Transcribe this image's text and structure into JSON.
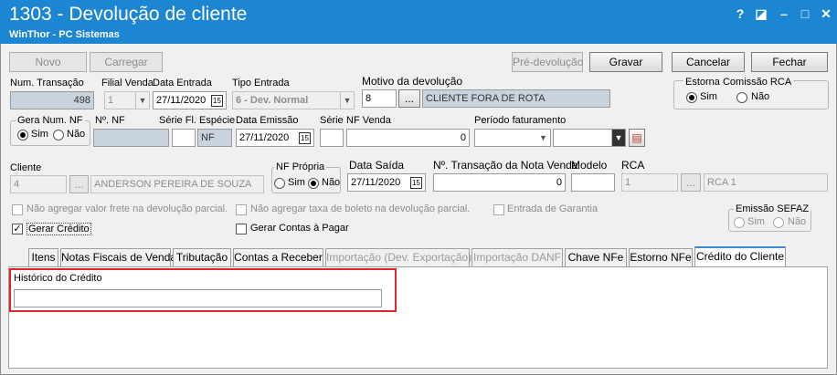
{
  "window": {
    "title": "1303 - Devolução de cliente",
    "subtitle": "WinThor - PC Sistemas",
    "btn_help": "?",
    "btn_edit": "◪",
    "btn_min": "–",
    "btn_max": "□",
    "btn_close": "✕"
  },
  "toolbar": {
    "novo": "Novo",
    "carregar": "Carregar",
    "pre_devolucao": "Pré-devolução",
    "gravar": "Gravar",
    "cancelar": "Cancelar",
    "fechar": "Fechar"
  },
  "row1": {
    "num_transacao_label": "Num. Transação",
    "num_transacao": "498",
    "filial_venda_label": "Filial Venda",
    "filial_venda": "1",
    "data_entrada_label": "Data Entrada",
    "data_entrada": "27/11/2020",
    "tipo_entrada_label": "Tipo Entrada",
    "tipo_entrada": "6 - Dev. Normal",
    "motivo_label": "Motivo da devolução",
    "motivo_codigo": "8",
    "motivo_btn": "...",
    "motivo_descricao": "CLIENTE FORA DE ROTA"
  },
  "estorna_comissao": {
    "label": "Estorna Comissão RCA",
    "sim": "Sim",
    "nao": "Não"
  },
  "row2": {
    "gera_num_nf_label": "Gera Num. NF",
    "sim": "Sim",
    "nao": "Não",
    "no_nf_label": "Nº. NF",
    "serie_especie_label": "Série Fl. Espécie",
    "especie": "NF",
    "data_emissao_label": "Data Emissão",
    "data_emissao": "27/11/2020",
    "serie_label": "Série",
    "nf_venda_label": "NF Venda",
    "nf_venda": "0",
    "periodo_label": "Período faturamento"
  },
  "row3": {
    "cliente_label": "Cliente",
    "cliente_codigo": "4",
    "cliente_btn": "...",
    "cliente_nome": "ANDERSON PEREIRA DE SOUZA",
    "nf_propria_label": "NF Própria",
    "sim": "Sim",
    "nao": "Não",
    "data_saida_label": "Data Saída",
    "data_saida": "27/11/2020",
    "transacao_nv_label": "Nº. Transação da Nota Venda",
    "transacao_nv": "0",
    "modelo_label": "Modelo",
    "rca_label": "RCA",
    "rca_codigo": "1",
    "rca_btn": "...",
    "rca_nome": "RCA 1"
  },
  "options": {
    "nao_agregar_frete": "Não agregar valor frete na devolução parcial.",
    "nao_agregar_boleto": "Não agregar taxa de boleto na devolução parcial.",
    "entrada_garantia": "Entrada de Garantia",
    "gerar_credito": "Gerar Crédito",
    "gerar_contas_pagar": "Gerar Contas à Pagar",
    "check_mark": "✓"
  },
  "emissao_sefaz": {
    "label": "Emissão SEFAZ",
    "sim": "Sim",
    "nao": "Não"
  },
  "tabs": [
    {
      "label": "Itens"
    },
    {
      "label": "Notas Fiscais de Venda"
    },
    {
      "label": "Tributação"
    },
    {
      "label": "Contas a Receber"
    },
    {
      "label": "Importação (Dev. Exportação)"
    },
    {
      "label": "Importação DANF"
    },
    {
      "label": "Chave NFe"
    },
    {
      "label": "Estorno NFe"
    },
    {
      "label": "Crédito do Cliente"
    }
  ],
  "credito_tab": {
    "historico_label": "Histórico do Crédito",
    "historico_value": ""
  },
  "icons": {
    "calendar": "15",
    "dropdown": "▼",
    "ellipsis": "...",
    "calendar_picker": "▤"
  },
  "colors": {
    "titlebar": "#1d86d3",
    "highlight": "#e0262c",
    "readonly_field": "#c9d3de"
  }
}
